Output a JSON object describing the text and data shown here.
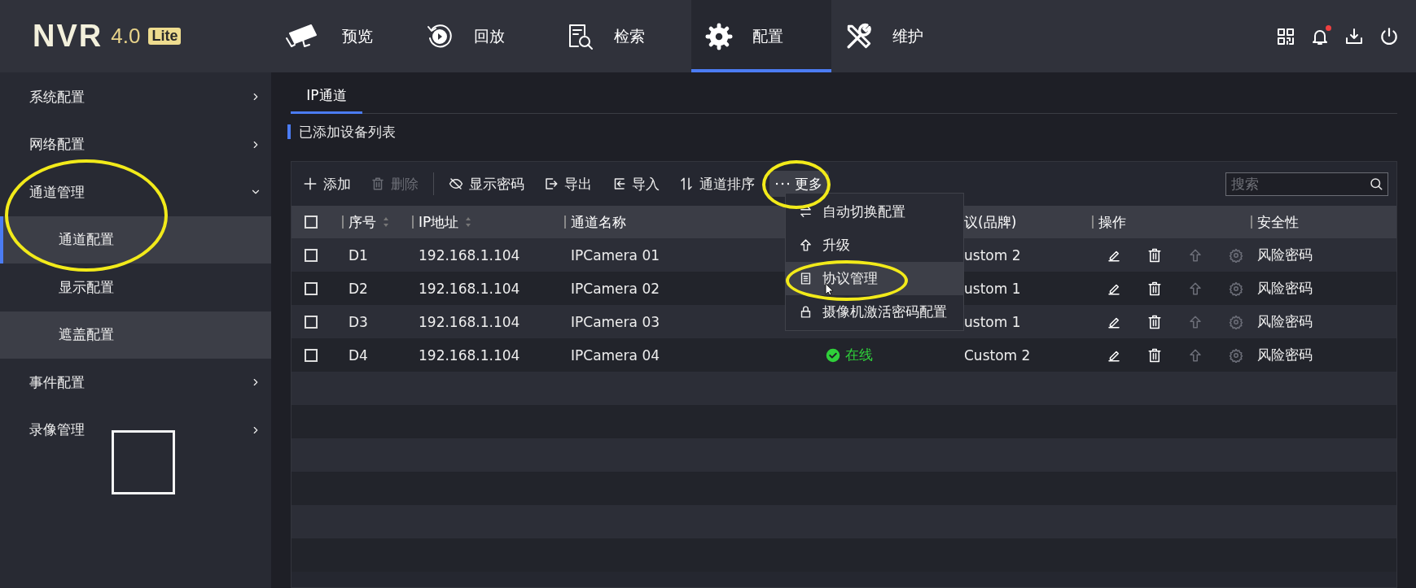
{
  "header": {
    "logo": {
      "name": "NVR",
      "version": "4.0",
      "edition": "Lite"
    },
    "nav": [
      {
        "label": "预览",
        "selected": false
      },
      {
        "label": "回放",
        "selected": false
      },
      {
        "label": "检索",
        "selected": false
      },
      {
        "label": "配置",
        "selected": true
      },
      {
        "label": "维护",
        "selected": false
      }
    ],
    "actions": [
      {
        "kind": "qr",
        "badge": false
      },
      {
        "kind": "bell",
        "badge": true
      },
      {
        "kind": "download",
        "badge": false
      },
      {
        "kind": "power",
        "badge": false
      }
    ]
  },
  "sidebar": {
    "marker_square": true,
    "items": [
      {
        "label": "系统配置",
        "expanded": false,
        "circled": false
      },
      {
        "label": "网络配置",
        "expanded": false,
        "circled": false
      },
      {
        "label": "通道管理",
        "expanded": true,
        "circled": true,
        "children": [
          {
            "label": "通道配置",
            "selected": true,
            "hovered": false
          },
          {
            "label": "显示配置",
            "selected": false,
            "hovered": false
          },
          {
            "label": "遮盖配置",
            "selected": false,
            "hovered": true
          }
        ]
      },
      {
        "label": "事件配置",
        "expanded": false,
        "circled": false
      },
      {
        "label": "录像管理",
        "expanded": false,
        "circled": false
      }
    ]
  },
  "tabs": [
    {
      "label": "IP通道",
      "selected": true
    }
  ],
  "section_title": "已添加设备列表",
  "toolbar": {
    "buttons": [
      {
        "label": "添加",
        "disabled": false
      },
      {
        "label": "删除",
        "disabled": true
      },
      {
        "label": "显示密码",
        "disabled": false
      },
      {
        "label": "导出",
        "disabled": false
      },
      {
        "label": "导入",
        "disabled": false
      },
      {
        "label": "通道排序",
        "disabled": false
      }
    ],
    "more": {
      "label": "更多",
      "open": true,
      "circled": true
    },
    "search": {
      "placeholder": "搜索"
    }
  },
  "table": {
    "columns": [
      {
        "kind": "checkbox",
        "checked": false
      },
      {
        "kind": "text",
        "label": "序号",
        "sortable": true
      },
      {
        "kind": "text",
        "label": "IP地址",
        "sortable": true
      },
      {
        "kind": "text",
        "label": "通道名称",
        "sortable": false
      },
      {
        "kind": "blank"
      },
      {
        "kind": "text",
        "label": "议(品牌)",
        "sortable": false
      },
      {
        "kind": "text",
        "label": "操作",
        "sortable": false
      },
      {
        "kind": "text",
        "label": "安全性",
        "sortable": false
      }
    ],
    "rows": [
      {
        "checked": false,
        "no": "D1",
        "ip": "192.168.1.104",
        "name": "IPCamera 01",
        "protocol": "ustom 2",
        "security": "风险密码",
        "actions": [
          {
            "kind": "edit",
            "disabled": false
          },
          {
            "kind": "delete",
            "disabled": false
          },
          {
            "kind": "upgrade",
            "disabled": true
          },
          {
            "kind": "settings",
            "disabled": true
          }
        ]
      },
      {
        "checked": false,
        "no": "D2",
        "ip": "192.168.1.104",
        "name": "IPCamera 02",
        "protocol": "ustom 1",
        "security": "风险密码",
        "actions": [
          {
            "kind": "edit",
            "disabled": false
          },
          {
            "kind": "delete",
            "disabled": false
          },
          {
            "kind": "upgrade",
            "disabled": true
          },
          {
            "kind": "settings",
            "disabled": true
          }
        ]
      },
      {
        "checked": false,
        "no": "D3",
        "ip": "192.168.1.104",
        "name": "IPCamera 03",
        "protocol": "ustom 1",
        "security": "风险密码",
        "actions": [
          {
            "kind": "edit",
            "disabled": false
          },
          {
            "kind": "delete",
            "disabled": false
          },
          {
            "kind": "upgrade",
            "disabled": true
          },
          {
            "kind": "settings",
            "disabled": true
          }
        ]
      },
      {
        "checked": false,
        "no": "D4",
        "ip": "192.168.1.104",
        "name": "IPCamera 04",
        "status": {
          "label": "在线",
          "online": true
        },
        "protocol": "Custom 2",
        "security": "风险密码",
        "actions": [
          {
            "kind": "edit",
            "disabled": false
          },
          {
            "kind": "delete",
            "disabled": false
          },
          {
            "kind": "upgrade",
            "disabled": true
          },
          {
            "kind": "settings",
            "disabled": true
          }
        ]
      }
    ]
  },
  "dropdown": {
    "items": [
      {
        "label": "自动切换配置",
        "hovered": false,
        "circled": false
      },
      {
        "label": "升级",
        "hovered": false,
        "circled": false
      },
      {
        "label": "协议管理",
        "hovered": true,
        "circled": true
      },
      {
        "label": "摄像机激活密码配置",
        "hovered": false,
        "circled": false
      }
    ]
  }
}
